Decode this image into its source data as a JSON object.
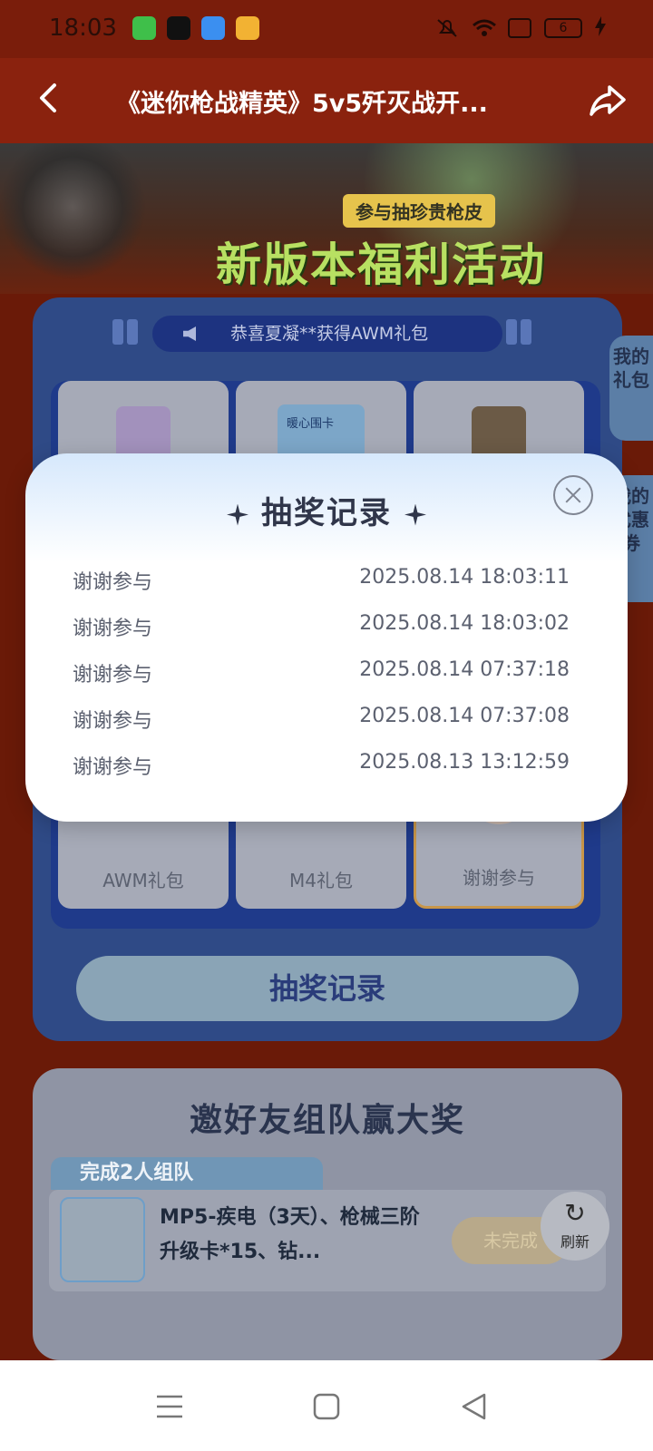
{
  "status": {
    "time": "18:03",
    "battery": "6"
  },
  "header": {
    "title": "《迷你枪战精英》5v5歼灭战开..."
  },
  "banner": {
    "subtitle": "参与抽珍贵枪皮",
    "title": "新版本福利活动"
  },
  "notice": {
    "text": "恭喜夏凝**获得AWM礼包"
  },
  "prizes": [
    {
      "label": "AWM礼包"
    },
    {
      "label": "M4礼包"
    },
    {
      "label": "谢谢参与"
    }
  ],
  "prize_card_text": "暖心围卡",
  "draw_record_button": "抽奖记录",
  "side_tabs": {
    "my_gifts": "我的礼包",
    "my_coupons": "我的优惠券"
  },
  "invite": {
    "title": "邀好友组队赢大奖",
    "team_tag": "完成2人组队",
    "task_text": "MP5-疾电（3天）、枪械三阶升级卡*15、钻...",
    "task_status": "未完成",
    "refresh_label": "刷新"
  },
  "modal": {
    "title": "抽奖记录",
    "records": [
      {
        "name": "谢谢参与",
        "time": "2025.08.14 18:03:11"
      },
      {
        "name": "谢谢参与",
        "time": "2025.08.14 18:03:02"
      },
      {
        "name": "谢谢参与",
        "time": "2025.08.14 07:37:18"
      },
      {
        "name": "谢谢参与",
        "time": "2025.08.14 07:37:08"
      },
      {
        "name": "谢谢参与",
        "time": "2025.08.13 13:12:59"
      }
    ]
  }
}
